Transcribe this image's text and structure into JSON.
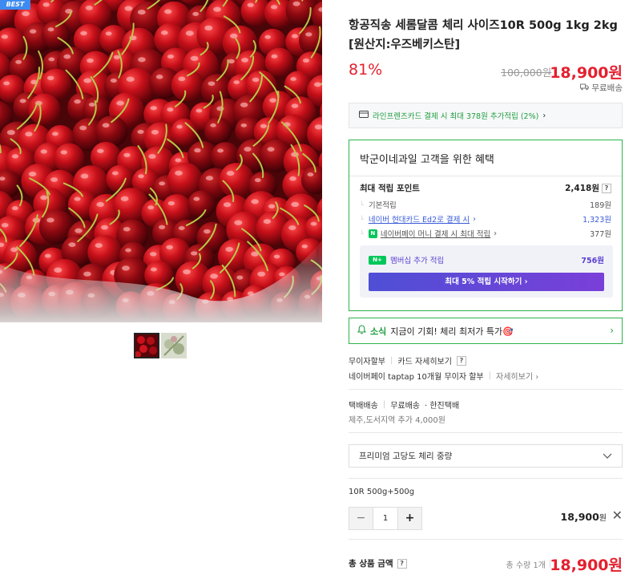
{
  "gallery": {
    "badge": "BEST",
    "thumbnail_count": 2
  },
  "product": {
    "title": "항공직송 세롬달콤 체리 사이즈10R 500g 1kg 2kg [원산지:우즈베키스탄]",
    "discount": "81%",
    "original_price": "100,000원",
    "sale_price": "18,900원",
    "shipping_badge": "무료배송"
  },
  "card_promo": {
    "text": "라인프렌즈카드 결제 시 최대 378원 추가적립 (2%)",
    "chevron": "›"
  },
  "benefits": {
    "title": "박군이네과일 고객을 위한 혜택",
    "max_points_label": "최대 적립 포인트",
    "max_points_value": "2,418원",
    "rows": [
      {
        "label": "기본적립",
        "value": "189원"
      },
      {
        "label": "네이버 현대카드 Ed2로 결제 시",
        "value": "1,323원"
      },
      {
        "label": "네이버페이 머니 결제 시 최대 적립",
        "value": "377원"
      }
    ],
    "membership_badge": "N+",
    "membership_label": "멤버십 추가 적립",
    "membership_value": "756원",
    "membership_button": "최대 5% 적립 시작하기 ›"
  },
  "news_banner": {
    "tag": "소식",
    "text": "지금이 기회! 체리 최저가 특가🎯"
  },
  "installment": {
    "label": "무이자할부",
    "card_link": "카드 자세히보기",
    "npay_text": "네이버페이 taptap 10개월 무이자 할부",
    "npay_link": "자세히보기 ›"
  },
  "delivery": {
    "label": "택배배송",
    "free": "무료배송",
    "courier": "· 한진택배",
    "extra": "제주,도서지역 추가 4,000원"
  },
  "option_select": {
    "selected": "프리미엄 고당도 체리 중량"
  },
  "selected_item": {
    "name": "10R 500g+500g",
    "quantity": "1",
    "price": "18,900",
    "price_unit": "원"
  },
  "total": {
    "label": "총 상품 금액",
    "count": "총 수량 1개",
    "price": "18,900원"
  },
  "colors": {
    "accent_red": "#e5202e",
    "naver_green": "#03c75a",
    "link_blue": "#3a5bd9",
    "membership_purple": "#5a3fd0"
  }
}
